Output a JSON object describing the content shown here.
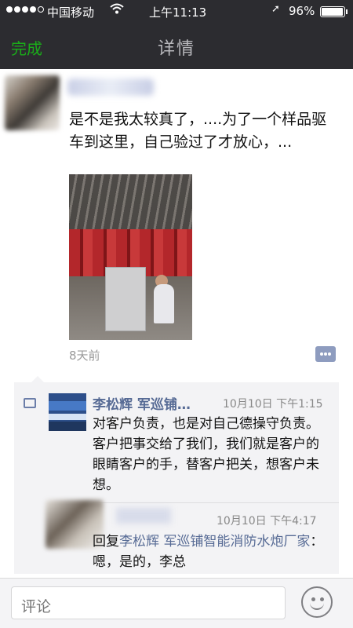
{
  "status_bar": {
    "signal": "●●●●○",
    "carrier": "中国移动",
    "wifi_icon": "wifi-icon",
    "time": "上午11:13",
    "location_icon": "➚",
    "battery_text": "96%",
    "battery_level": 0.96
  },
  "nav": {
    "done_label": "完成",
    "title": "详情"
  },
  "post": {
    "text": "是不是我太较真了，....为了一个样品驱车到这里，自己验过了才放心，...",
    "time": "8天前"
  },
  "comments": [
    {
      "author": "李松辉  军巡铺…",
      "time": "10月10日 下午1:15",
      "text": "对客户负责，也是对自己德操守负责。客户把事交给了我们，我们就是客户的眼睛客户的手，替客户把关，想客户未想。"
    },
    {
      "time": "10月10日 下午4:17",
      "reply_prefix": "回复",
      "reply_to": "李松辉  军巡铺智能消防水炮厂家",
      "text": "：嗯，是的，李总"
    }
  ],
  "input": {
    "placeholder": "评论"
  },
  "colors": {
    "nav_bg": "#2c2c30",
    "done_green": "#1aad19",
    "link_blue": "#576b95"
  }
}
